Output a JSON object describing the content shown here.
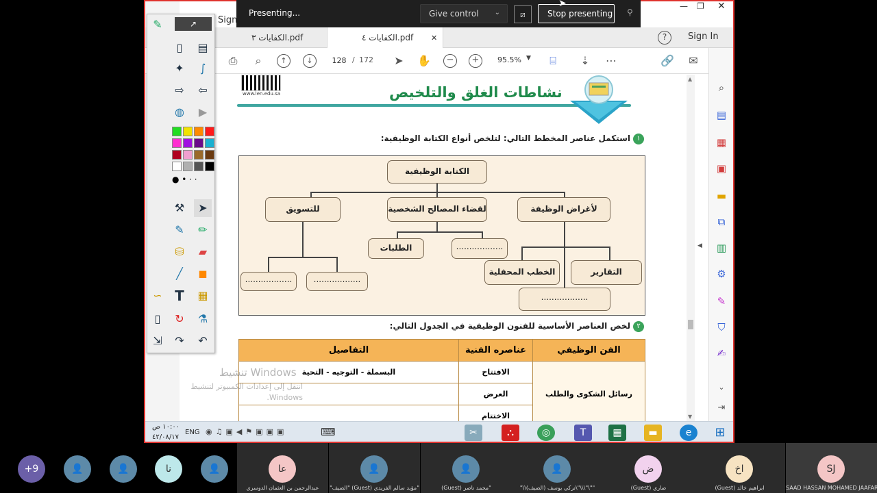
{
  "meeting_bar": {
    "status": "Presenting...",
    "give_control": "Give control",
    "stop_presenting": "Stop presenting"
  },
  "window_controls": {
    "sign": "Sign",
    "sign_in": "Sign In"
  },
  "tabs": [
    {
      "label": "الكفايات ٤.pdf",
      "active": true
    },
    {
      "label": "الكفايات ٣.pdf",
      "active": false
    }
  ],
  "toolbar": {
    "current_page": "128",
    "page_sep": "/",
    "total_pages": "172",
    "zoom": "95.5%"
  },
  "document": {
    "qr_caption": "www.len.edu.sa",
    "banner_title": "نشاطات الغلق والتلخيص",
    "q1": "استكمل عناصر المخطط التالي: لتلخص أنواع الكتابة الوظيفية:",
    "q1_num": "١",
    "diagram": {
      "root": "الكتابة الوظيفية",
      "branch_marketing": "للتسويق",
      "branch_personal": "لقضاء المصالح الشخصية",
      "branch_job": "لأغراض الوظيفة",
      "requests": "الطلبات",
      "placeholder": "..................",
      "reports": "التقارير",
      "speeches": "الخطب المحفلية"
    },
    "q2": "لخص العناصر الأساسية للفنون الوظيفية في الجدول التالي:",
    "q2_num": "٢",
    "table": {
      "headers": [
        "الفن الوظيفي",
        "عناصره الفنية",
        "التفاصيل"
      ],
      "art": "رسائل الشكوى والطلب",
      "rows": [
        {
          "element": "الافتتاح",
          "details": "البسملة - التوجيه - التحية"
        },
        {
          "element": "العرض",
          "details": ""
        },
        {
          "element": "الاختتام",
          "details": ""
        }
      ]
    },
    "watermark_title": "تنشيط Windows",
    "watermark_body": "انتقل إلى إعدادات الكمبيوتر لتنشيط Windows."
  },
  "taskbar": {
    "language": "ENG",
    "time": "١٠:٠٠ ص",
    "date": "٤٢/٠٨/١٧"
  },
  "participants": [
    {
      "initials": "+9",
      "name": "",
      "color": "#6b5fa8"
    },
    {
      "initials": "",
      "name": "",
      "color": "#5d8aa8"
    },
    {
      "initials": "",
      "name": "",
      "color": "#5d8aa8"
    },
    {
      "initials": "نا",
      "name": "",
      "color": "#bde8ea"
    },
    {
      "initials": "",
      "name": "",
      "color": "#5d8aa8"
    },
    {
      "initials": "عا",
      "name": "عبدالرحمن بن العثمان الدوسري",
      "color": "#f4c6c6"
    },
    {
      "initials": "",
      "name": "\"الضيف\" (Guest) مؤيد سالم الفريدي\"",
      "color": "#5d8aa8"
    },
    {
      "initials": "",
      "name": "(Guest) محمد ناصر\"",
      "color": "#5d8aa8"
    },
    {
      "initials": "",
      "name": "\"\\\\(تركي يوسف (الضيف\\\"\\\\\\\"\\\"\"",
      "color": "#5d8aa8"
    },
    {
      "initials": "ض",
      "name": "(Guest) ضاري",
      "color": "#f2d2ee"
    },
    {
      "initials": "اخ",
      "name": "(Guest) ابراهيم خالد",
      "color": "#f7e3c2"
    },
    {
      "initials": "SJ",
      "name": "SAAD HASSAN MOHAMED JAAFAR",
      "color": "#f4c6c6"
    }
  ],
  "colors": {
    "accent_red": "#e0342f",
    "pres_bar": "#1f1f1f",
    "doc_orange": "#f5b457",
    "diagram_fill": "#fbf1e2"
  }
}
